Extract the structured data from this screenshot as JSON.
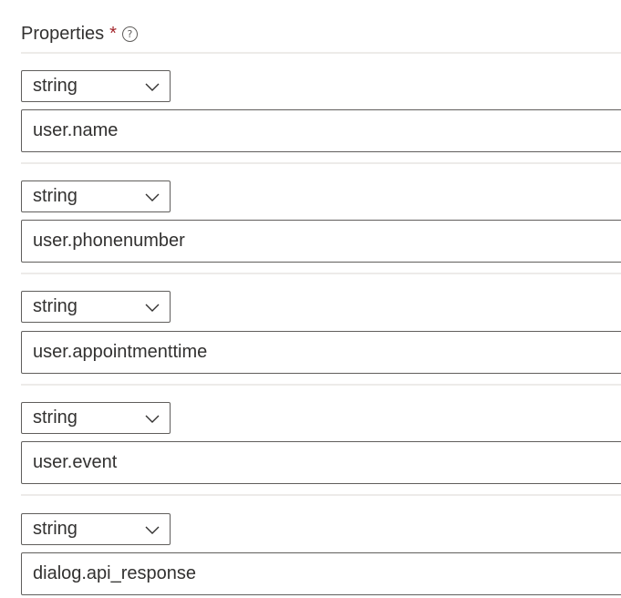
{
  "header": {
    "title": "Properties",
    "required_marker": "*",
    "help_icon": "question-circle-icon"
  },
  "properties": [
    {
      "type": "string",
      "value": "user.name"
    },
    {
      "type": "string",
      "value": "user.phonenumber"
    },
    {
      "type": "string",
      "value": "user.appointmenttime"
    },
    {
      "type": "string",
      "value": "user.event"
    },
    {
      "type": "string",
      "value": "dialog.api_response"
    }
  ],
  "colors": {
    "text": "#323130",
    "border": "#605e5c",
    "divider": "#edebe9",
    "required": "#a4262c"
  }
}
